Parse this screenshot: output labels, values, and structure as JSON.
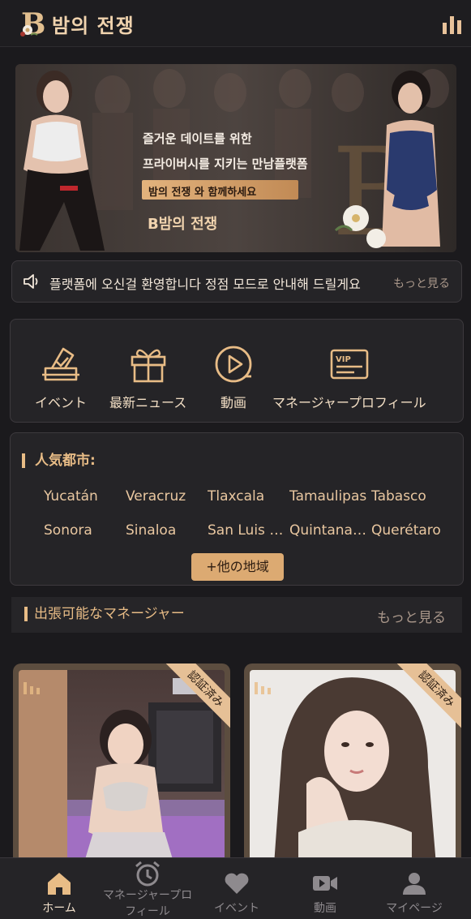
{
  "header": {
    "brand_letter": "B",
    "brand_name": "밤의 전쟁"
  },
  "banner": {
    "line1": "즐거운 데이트를 위한",
    "line2": "프라이버시를 지키는 만남플랫폼",
    "cta": "밤의 전쟁  와  함께하세요",
    "brand": "B밤의 전쟁"
  },
  "notice": {
    "icon": "speaker-icon",
    "text": "플랫폼에 오신걸 환영합니다 정점 모드로 안내해 드릴게요",
    "more": "もっと見る"
  },
  "quick_nav": [
    {
      "label": "イベント",
      "icon": "ballot-check-icon"
    },
    {
      "label": "最新ニュース",
      "icon": "gift-icon"
    },
    {
      "label": "動画",
      "icon": "play-icon"
    },
    {
      "label": "マネージャープロフィール",
      "icon": "vip-card-icon"
    }
  ],
  "cities": {
    "title": "人気都市:",
    "items": [
      "Yucatán",
      "Veracruz",
      "Tlaxcala",
      "Tamaulipas",
      "Tabasco",
      "Sonora",
      "Sinaloa",
      "San Luis …",
      "Quintana …",
      "Querétaro"
    ],
    "more_button": "+他の地域"
  },
  "managers": {
    "title": "出張可能なマネージャー",
    "more": "もっと見る",
    "cards": [
      {
        "badge": "認証済み"
      },
      {
        "badge": "認証済み"
      }
    ]
  },
  "tabbar": [
    {
      "label": "ホーム",
      "icon": "home-icon",
      "active": true
    },
    {
      "label": "マネージャープロフィール",
      "icon": "alarm-clock-icon",
      "active": false
    },
    {
      "label": "イベント",
      "icon": "heart-icon",
      "active": false
    },
    {
      "label": "動画",
      "icon": "video-camera-icon",
      "active": false
    },
    {
      "label": "マイページ",
      "icon": "user-icon",
      "active": false
    }
  ],
  "colors": {
    "background": "#1b1a1d",
    "accent": "#e8bc86",
    "panel": "#252427"
  }
}
